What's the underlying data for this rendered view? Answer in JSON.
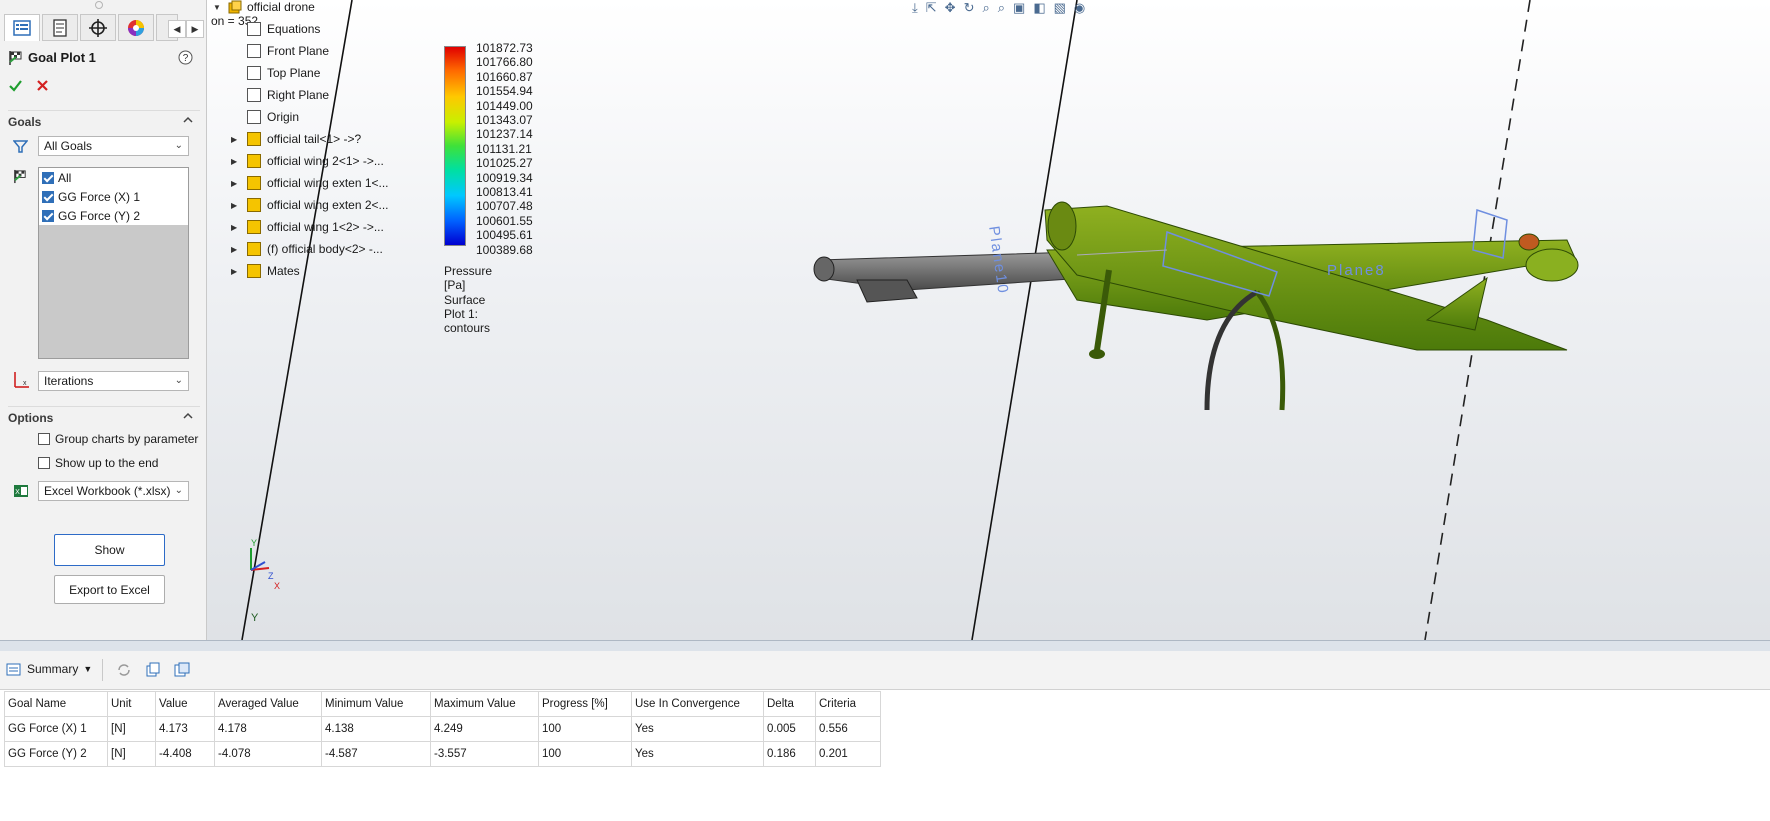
{
  "left_panel": {
    "title": "Goal Plot 1",
    "goals_section": "Goals",
    "goals_filter": "All Goals",
    "goal_items": [
      "All",
      "GG Force (X) 1",
      "GG Force (Y) 2"
    ],
    "x_axis": "Iterations",
    "options_section": "Options",
    "options": [
      "Group charts by parameter",
      "Show up to the end"
    ],
    "export_format": "Excel Workbook (*.xlsx)",
    "show_button": "Show",
    "export_button": "Export to Excel"
  },
  "tree": {
    "root": "official drone",
    "overlay_text": "on = 352",
    "items": [
      {
        "label": "Equations",
        "expandable": false
      },
      {
        "label": "Front Plane",
        "expandable": false
      },
      {
        "label": "Top Plane",
        "expandable": false
      },
      {
        "label": "Right Plane",
        "expandable": false
      },
      {
        "label": "Origin",
        "expandable": false
      },
      {
        "label": "official tail<1> ->?",
        "expandable": true
      },
      {
        "label": "official wing 2<1> ->...",
        "expandable": true
      },
      {
        "label": "official wing exten 1<...",
        "expandable": true
      },
      {
        "label": "official wing exten 2<...",
        "expandable": true
      },
      {
        "label": "official wing 1<2> ->...",
        "expandable": true
      },
      {
        "label": "(f) official body<2> -...",
        "expandable": true
      },
      {
        "label": "Mates",
        "expandable": true
      }
    ]
  },
  "legend": {
    "values": [
      "101872.73",
      "101766.80",
      "101660.87",
      "101554.94",
      "101449.00",
      "101343.07",
      "101237.14",
      "101131.21",
      "101025.27",
      "100919.34",
      "100813.41",
      "100707.48",
      "100601.55",
      "100495.61",
      "100389.68"
    ],
    "unit_label": "Pressure [Pa]",
    "plot_label": "Surface Plot 1: contours"
  },
  "viewport_labels": {
    "plane_left": "Plane10",
    "plane_right": "Plane8",
    "axis_y": "Y",
    "triad_y": "Y",
    "triad_z": "Z",
    "triad_x": "X"
  },
  "results": {
    "tab_label": "Summary",
    "columns": [
      "Goal Name",
      "Unit",
      "Value",
      "Averaged Value",
      "Minimum Value",
      "Maximum Value",
      "Progress [%]",
      "Use In Convergence",
      "Delta",
      "Criteria"
    ],
    "rows": [
      [
        "GG Force (X) 1",
        "[N]",
        "4.173",
        "4.178",
        "4.138",
        "4.249",
        "100",
        "Yes",
        "0.005",
        "0.556"
      ],
      [
        "GG Force (Y) 2",
        "[N]",
        "-4.408",
        "-4.078",
        "-4.587",
        "-3.557",
        "100",
        "Yes",
        "0.186",
        "0.201"
      ]
    ]
  },
  "colors": {
    "accent": "#2f6fb8",
    "ok_green": "#1e9e2e",
    "cancel_red": "#d42020",
    "model_green": "#5c8a10",
    "plane_blue": "#6f8fe0"
  }
}
